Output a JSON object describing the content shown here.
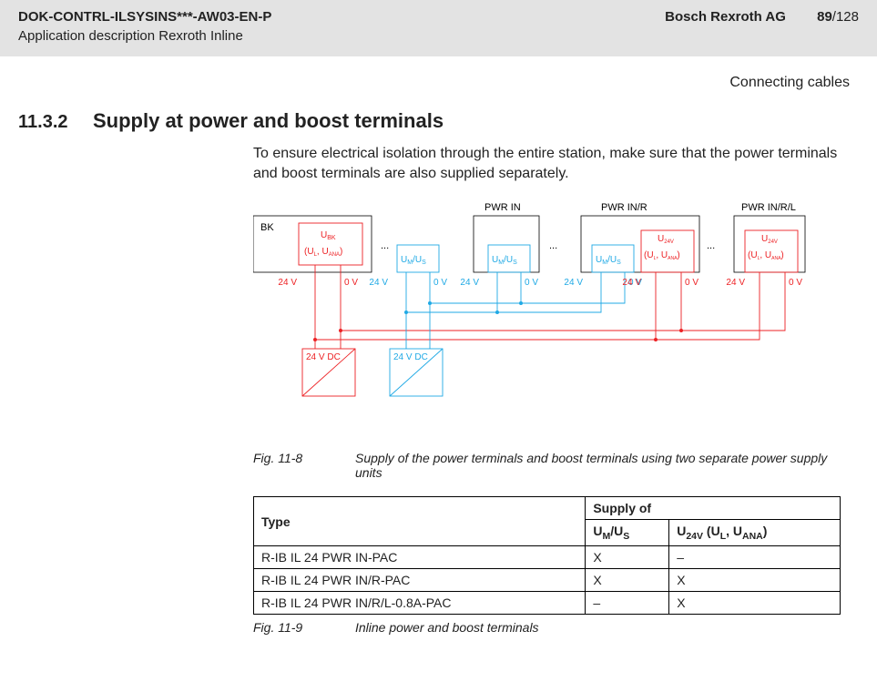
{
  "header": {
    "doc_id": "DOK-CONTRL-ILSYSINS***-AW03-EN-P",
    "subtitle": "Application description Rexroth Inline",
    "company": "Bosch Rexroth AG",
    "page_cur": "89",
    "page_total": "/128",
    "chapter": "Connecting cables"
  },
  "section": {
    "number": "11.3.2",
    "title": "Supply at power and boost terminals"
  },
  "intro": "To ensure electrical isolation through the entire station, make sure that the power terminals and boost terminals are also supplied separately.",
  "figure": {
    "bk": "BK",
    "u_bk": "U",
    "u_bk_sub": "BK",
    "ul_uana": "(U",
    "ul_uana_l": "L",
    "ul_uana_mid": ", U",
    "ul_uana_ana": "ANA",
    "ul_uana_close": ")",
    "umus": "U",
    "umus_m": "M",
    "umus_slash": "/U",
    "umus_s": "S",
    "u24v": "U",
    "u24v_sub": "24V",
    "pwr_in": "PWR IN",
    "pwr_inr": "PWR IN/R",
    "pwr_inrl": "PWR IN/R/L",
    "v24": "24 V",
    "v0": "0 V",
    "dc24": "24 V DC",
    "dots": "..."
  },
  "figcap1": {
    "label": "Fig. 11-8",
    "text": "Supply of the power terminals and boost terminals using two separate power supply units"
  },
  "table": {
    "h_type": "Type",
    "h_supply": "Supply of",
    "h_umus": "U",
    "h_umus_m": "M",
    "h_umus_slash": "/U",
    "h_umus_s": "S",
    "h_u24": "U",
    "h_u24_sub": "24V",
    "h_u24_paren": " (U",
    "h_u24_l": "L",
    "h_u24_mid": ", U",
    "h_u24_ana": "ANA",
    "h_u24_close": ")",
    "rows": [
      {
        "type": "R-IB IL 24 PWR IN-PAC",
        "c1": "X",
        "c2": "–"
      },
      {
        "type": "R-IB IL 24 PWR IN/R-PAC",
        "c1": "X",
        "c2": "X"
      },
      {
        "type": "R-IB IL 24 PWR IN/R/L-0.8A-PAC",
        "c1": "–",
        "c2": "X"
      }
    ]
  },
  "figcap2": {
    "label": "Fig. 11-9",
    "text": "Inline power and boost terminals"
  }
}
